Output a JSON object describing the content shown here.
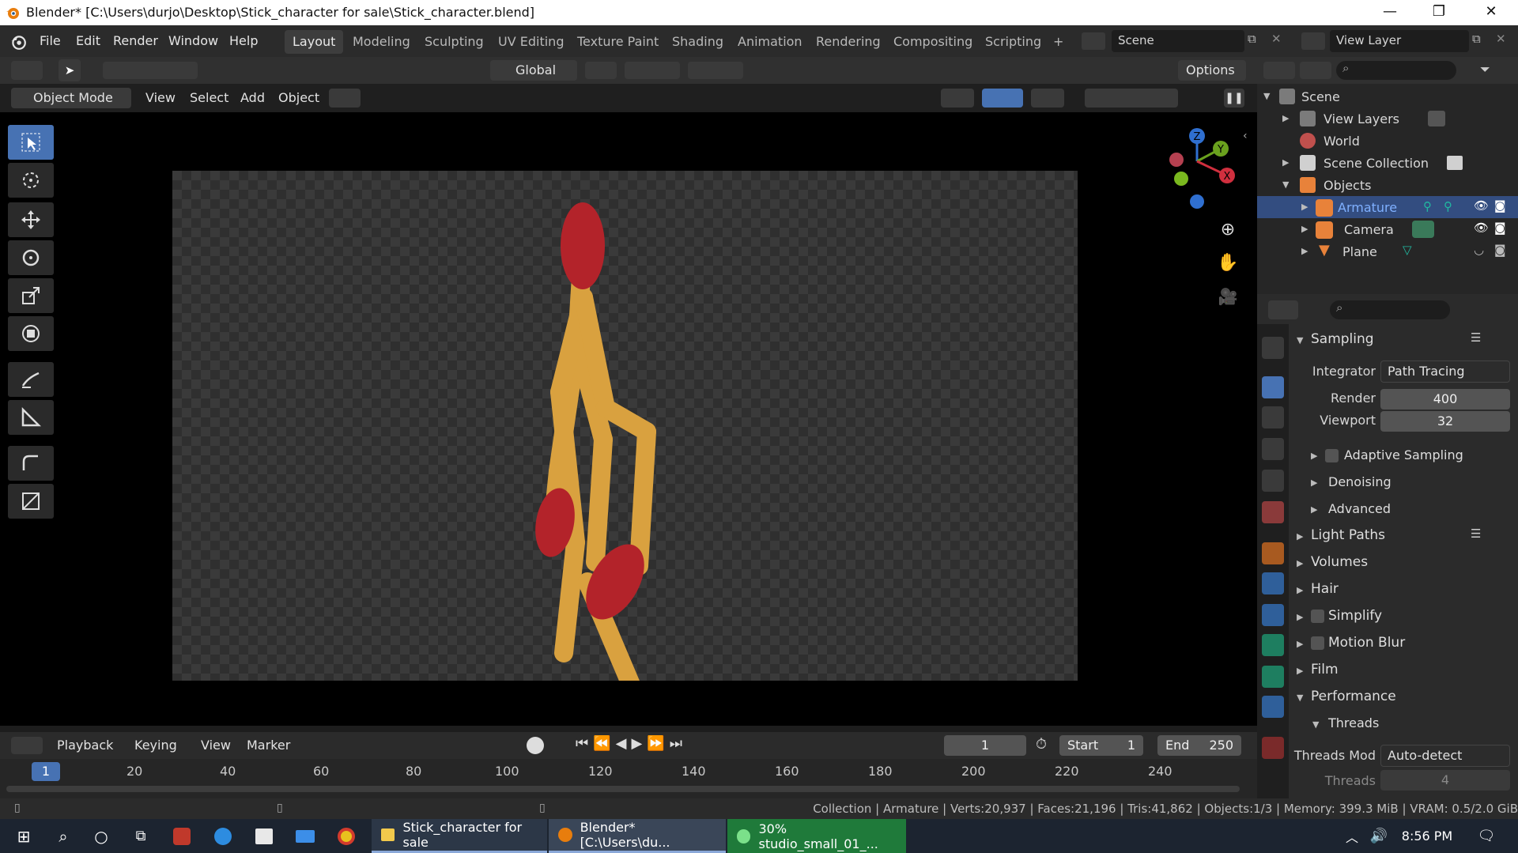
{
  "window": {
    "title": "Blender* [C:\\Users\\durjo\\Desktop\\Stick_character for sale\\Stick_character.blend]",
    "minimize": "—",
    "maximize": "❐",
    "close": "✕"
  },
  "menu": [
    "File",
    "Edit",
    "Render",
    "Window",
    "Help"
  ],
  "workspaces": [
    "Layout",
    "Modeling",
    "Sculpting",
    "UV Editing",
    "Texture Paint",
    "Shading",
    "Animation",
    "Rendering",
    "Compositing",
    "Scripting"
  ],
  "workspace_add": "+",
  "scene_name": "Scene",
  "view_layer_name": "View Layer",
  "toolhdr": {
    "orientation": "Global",
    "options": "Options"
  },
  "viewhdr": {
    "mode": "Object Mode",
    "view": "View",
    "select": "Select",
    "add": "Add",
    "object": "Object"
  },
  "gizmo": {
    "x": "X",
    "y": "Y",
    "z": "Z"
  },
  "outliner": {
    "scene": "Scene",
    "view_layers": "View Layers",
    "world": "World",
    "scene_collection": "Scene Collection",
    "objects": "Objects",
    "armature": "Armature",
    "camera": "Camera",
    "plane": "Plane"
  },
  "properties": {
    "sampling": "Sampling",
    "integrator_label": "Integrator",
    "integrator_value": "Path Tracing",
    "render_label": "Render",
    "render_value": "400",
    "viewport_label": "Viewport",
    "viewport_value": "32",
    "adaptive_sampling": "Adaptive Sampling",
    "denoising": "Denoising",
    "advanced": "Advanced",
    "light_paths": "Light Paths",
    "volumes": "Volumes",
    "hair": "Hair",
    "simplify": "Simplify",
    "motion_blur": "Motion Blur",
    "film": "Film",
    "performance": "Performance",
    "threads": "Threads",
    "threads_mode_label": "Threads Mod",
    "threads_mode_value": "Auto-detect",
    "threads_label": "Threads",
    "threads_value": "4"
  },
  "timeline": {
    "playback": "Playback",
    "keying": "Keying",
    "view": "View",
    "marker": "Marker",
    "current_frame": "1",
    "start_label": "Start",
    "start_value": "1",
    "end_label": "End",
    "end_value": "250",
    "ticks": [
      "20",
      "40",
      "60",
      "80",
      "100",
      "120",
      "140",
      "160",
      "180",
      "200",
      "220",
      "240"
    ],
    "playhead": "1"
  },
  "status": "Collection | Armature | Verts:20,937 | Faces:21,196 | Tris:41,862 | Objects:1/3 | Memory: 399.3 MiB | VRAM: 0.5/2.0 GiB",
  "taskbar": {
    "item1": "Stick_character for sale",
    "item2": "Blender* [C:\\Users\\du...",
    "item3": "30% studio_small_01_...",
    "time": "8:56 PM"
  },
  "colors": {
    "accent": "#4772b3",
    "selected_row": "#334d80",
    "armature_text": "#7fb0ff",
    "stick_body": "#d9a13f",
    "stick_tip": "#b3232a"
  }
}
